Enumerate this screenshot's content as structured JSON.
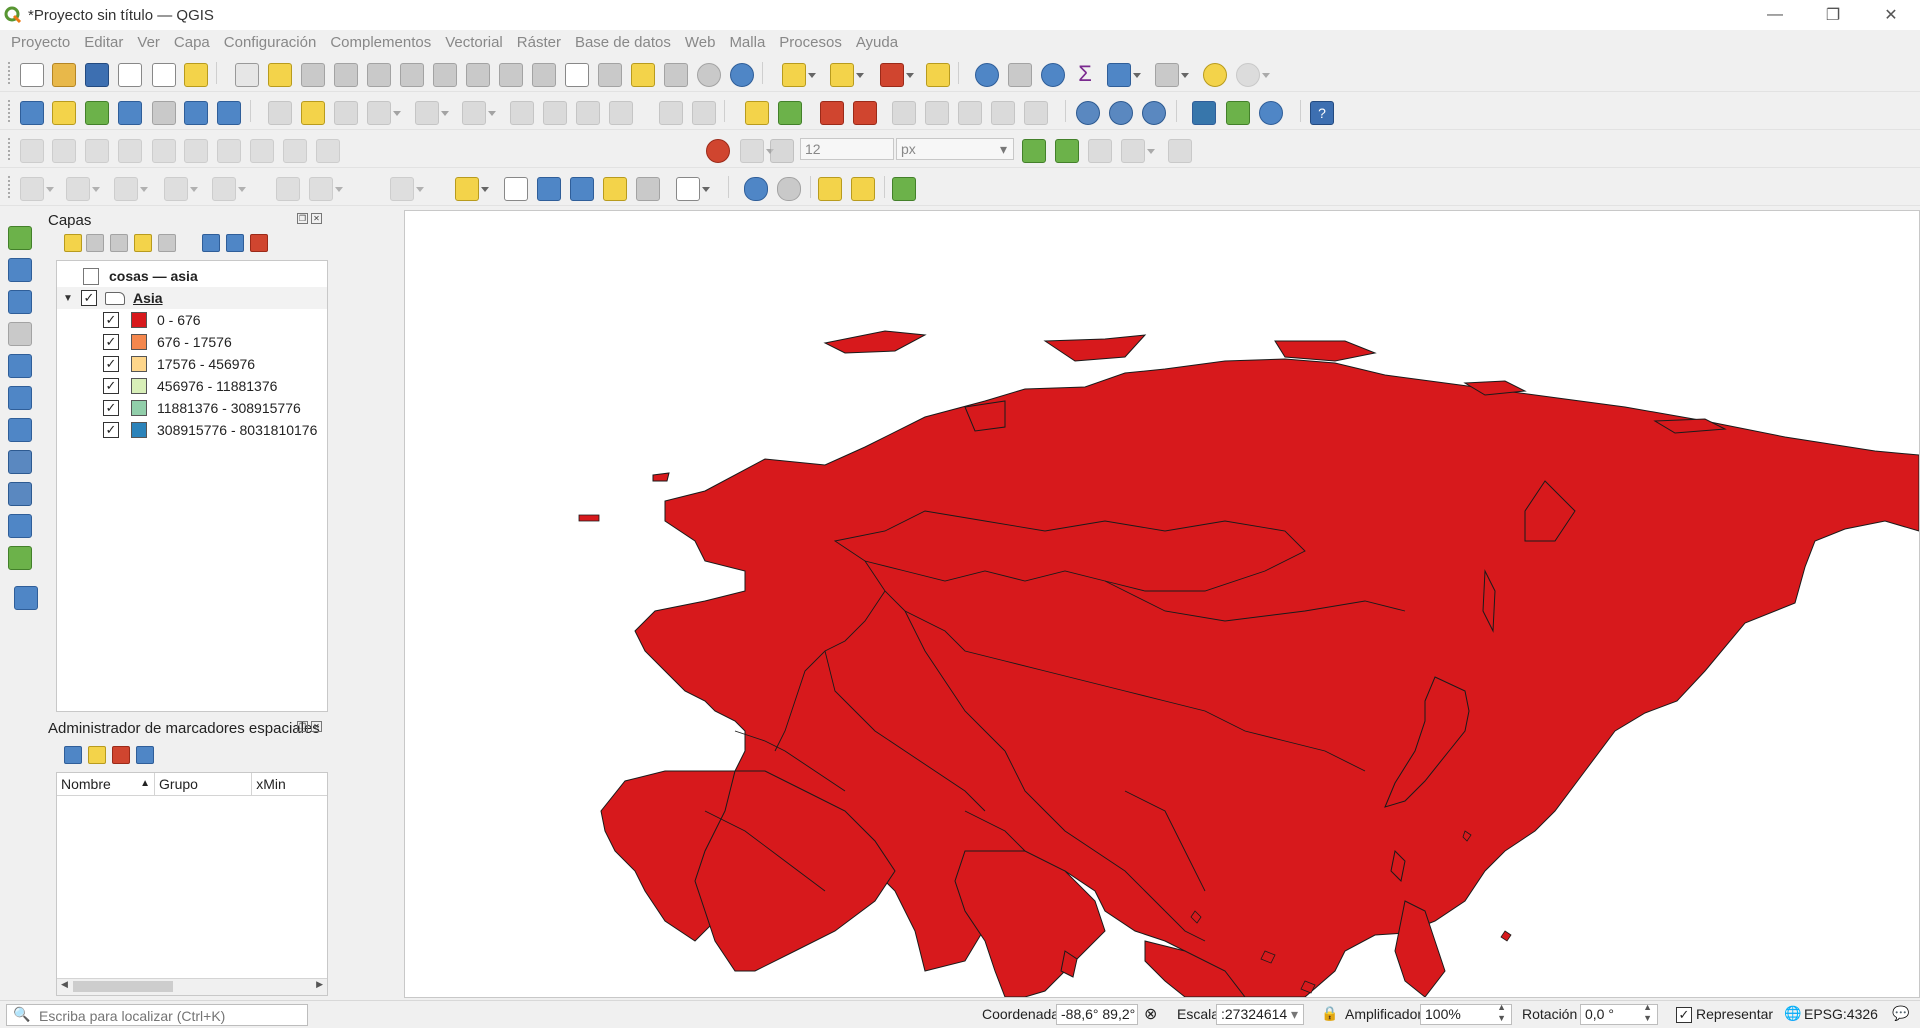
{
  "window": {
    "title": "*Proyecto sin título — QGIS",
    "min": "—",
    "max": "❐",
    "close": "✕"
  },
  "menu": [
    "Proyecto",
    "Editar",
    "Ver",
    "Capa",
    "Configuración",
    "Complementos",
    "Vectorial",
    "Ráster",
    "Base de datos",
    "Web",
    "Malla",
    "Procesos",
    "Ayuda"
  ],
  "layers_panel": {
    "title": "Capas",
    "items": [
      {
        "label": "cosas — asia"
      },
      {
        "label": "Asia"
      }
    ],
    "legend": [
      {
        "label": "0 - 676",
        "color": "#d7191c"
      },
      {
        "label": "676 - 17576",
        "color": "#f4874d"
      },
      {
        "label": "17576 - 456976",
        "color": "#fed68b"
      },
      {
        "label": "456976 - 11881376",
        "color": "#d8efb8"
      },
      {
        "label": "11881376 - 308915776",
        "color": "#91ceaa"
      },
      {
        "label": "308915776 - 8031810176",
        "color": "#2b83ba"
      }
    ]
  },
  "bookmarks_panel": {
    "title": "Administrador de marcadores espaciales",
    "columns": [
      "Nombre",
      "Grupo",
      "xMin"
    ]
  },
  "snapping": {
    "tolerance": "12",
    "units": "px"
  },
  "map": {
    "fill_color": "#d7191c",
    "stroke_color": "#1a1a1a"
  },
  "status": {
    "locator_placeholder": "Escriba para localizar (Ctrl+K)",
    "coord_label": "Coordenada",
    "coord_value": "-88,6° 89,2°",
    "scale_label": "Escala",
    "scale_value": ":27324614",
    "magnifier_label": "Amplificador",
    "magnifier_value": "100%",
    "rotation_label": "Rotación",
    "rotation_value": "0,0 °",
    "render_label": "Representar",
    "crs": "EPSG:4326"
  }
}
